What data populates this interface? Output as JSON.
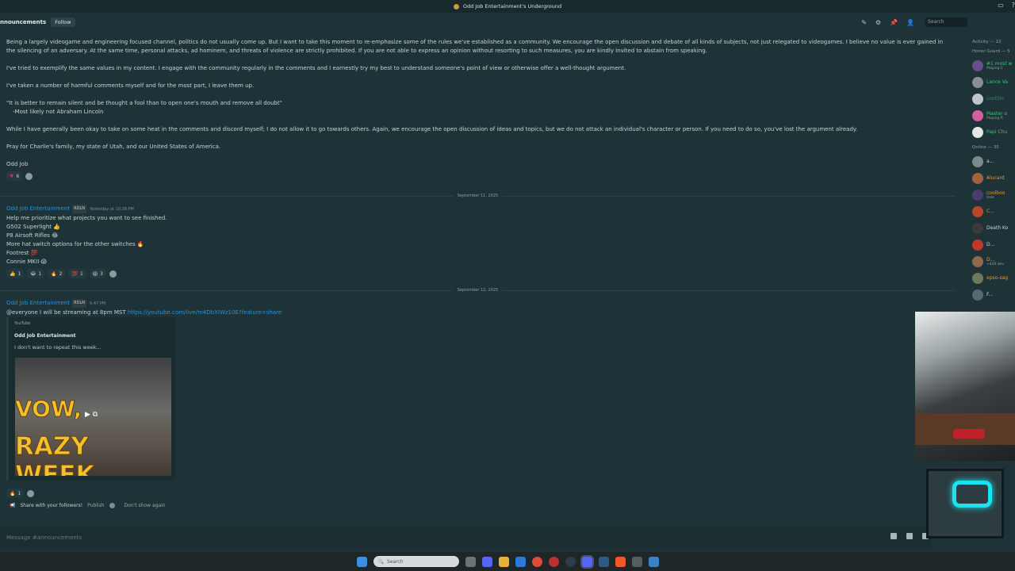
{
  "window": {
    "title": "Odd Job Entertainment's Underground"
  },
  "channel": {
    "name": "nnouncements",
    "follow_label": "Follow",
    "search_placeholder": "Search"
  },
  "post1": {
    "p1": "Being a largely videogame and engineering focused channel, politics do not usually come up.  But I want to take this moment to re-emphasize some of the rules we've established as a community.  We encourage the open discussion and debate of all kinds of subjects, not just relegated to videogames.  I believe no value is ever gained in the silencing of an adversary.  At the same time, personal attacks, ad hominem, and threats of violence are strictly prohibited.  If you are not able to express an opinion without resorting to such measures, you are kindly invited to abstain from speaking.",
    "p2": "I've tried to exemplify the same values in my content.  I engage with the community regularly in the comments and I earnestly try my best to understand someone's point of view or otherwise offer a well-thought argument.",
    "p3": "I've taken a number of harmful comments myself and for the most part, I leave them up.",
    "quote": "\"It is better to remain silent and be thought a fool than to open one's mouth and remove all doubt\"",
    "quote_attr": "-Most likely not Abraham Lincoln",
    "p4": "While I have generally been okay to take on some heat in the comments and discord myself; I do not allow it to go towards others.  Again, we encourage the open discussion of ideas and topics, but we do not attack an individual's character or person.  If you need to do so, you've lost the argument already.",
    "p5": "Pray for Charlie's family, my state of Utah, and our United States of America.",
    "sign": "Odd Job",
    "reaction_count": "6"
  },
  "divider1": "September 11, 2025",
  "post2": {
    "author": "Odd Job Entertainment",
    "tag": "RDLN",
    "time": "Yesterday at 10:28 PM",
    "lines": [
      "Help me prioritize what projects you want to see finished.",
      "G502 Superlight 👍",
      "P8 Airsoft Rifles 😂",
      "More hat switch options for the other switches 🔥",
      "Footrest 💯",
      "Connie MKII 😱"
    ],
    "reactions": [
      {
        "emoji": "👍",
        "count": "1"
      },
      {
        "emoji": "😂",
        "count": "1"
      },
      {
        "emoji": "🔥",
        "count": "2"
      },
      {
        "emoji": "💯",
        "count": "1"
      },
      {
        "emoji": "😱",
        "count": "3"
      }
    ]
  },
  "divider2": "September 12, 2025",
  "post3": {
    "author": "Odd Job Entertainment",
    "tag": "RDLN",
    "time": "6:47 PM",
    "text": "@everyone I will be streaming at 8pm MST",
    "link": "https://youtube.com/live/m4DbXIWz10E?feature=share",
    "embed_provider": "YouTube",
    "embed_title": "Odd Job Entertainment",
    "embed_desc": "I don't want to repeat this week...",
    "thumb_line1": "VOW,",
    "thumb_line2": "RAZY WEEK",
    "reaction_count": "1"
  },
  "share": {
    "text": "Share with your followers!",
    "publish": "Publish",
    "dont_show": "Don't show again"
  },
  "composer": {
    "placeholder": "Message #announcements"
  },
  "members": {
    "activity_header": "Activity — 22",
    "honor_header": "Honor Guard — 5",
    "online_header": "Online — 35",
    "honor": [
      {
        "name": "#1 most w",
        "sub": "Playing C",
        "color": "#2ecc71",
        "avatar": "#6a4d8c"
      },
      {
        "name": "Lance Va",
        "sub": "",
        "color": "#2ecc71",
        "avatar": "#8a8f93"
      },
      {
        "name": "LootSlo",
        "sub": "",
        "color": "#2e8c6a",
        "avatar": "#bfc4c6"
      },
      {
        "name": "Master o",
        "sub": "Playing R",
        "color": "#2ecc71",
        "avatar": "#d45fa1"
      },
      {
        "name": "Papi Chu",
        "sub": "",
        "color": "#2ecc71",
        "avatar": "#e6e6e6"
      }
    ],
    "online": [
      {
        "name": "a...",
        "sub": "",
        "color": "#cfd8d8",
        "avatar": "#7c8a8c"
      },
      {
        "name": "Alucard",
        "sub": "",
        "color": "#e39b2d",
        "avatar": "#a0623a"
      },
      {
        "name": "coolboo",
        "sub": "User",
        "color": "#e39b2d",
        "avatar": "#4b3c6e"
      },
      {
        "name": "C...",
        "sub": "",
        "color": "#e39b2d",
        "avatar": "#b7472a"
      },
      {
        "name": "Death Ko",
        "sub": "",
        "color": "#cfd8d8",
        "avatar": "#3b3b3b"
      },
      {
        "name": "D...",
        "sub": "",
        "color": "#cfd8d8",
        "avatar": "#c0392b"
      },
      {
        "name": "D...",
        "sub": "+420 dev",
        "color": "#e39b2d",
        "avatar": "#8e6a4f"
      },
      {
        "name": "epso-sag",
        "sub": "",
        "color": "#e39b2d",
        "avatar": "#6e7b5a"
      },
      {
        "name": "F...",
        "sub": "",
        "color": "#cfd8d8",
        "avatar": "#556b6e"
      }
    ]
  },
  "taskbar": {
    "search_placeholder": "Search"
  }
}
